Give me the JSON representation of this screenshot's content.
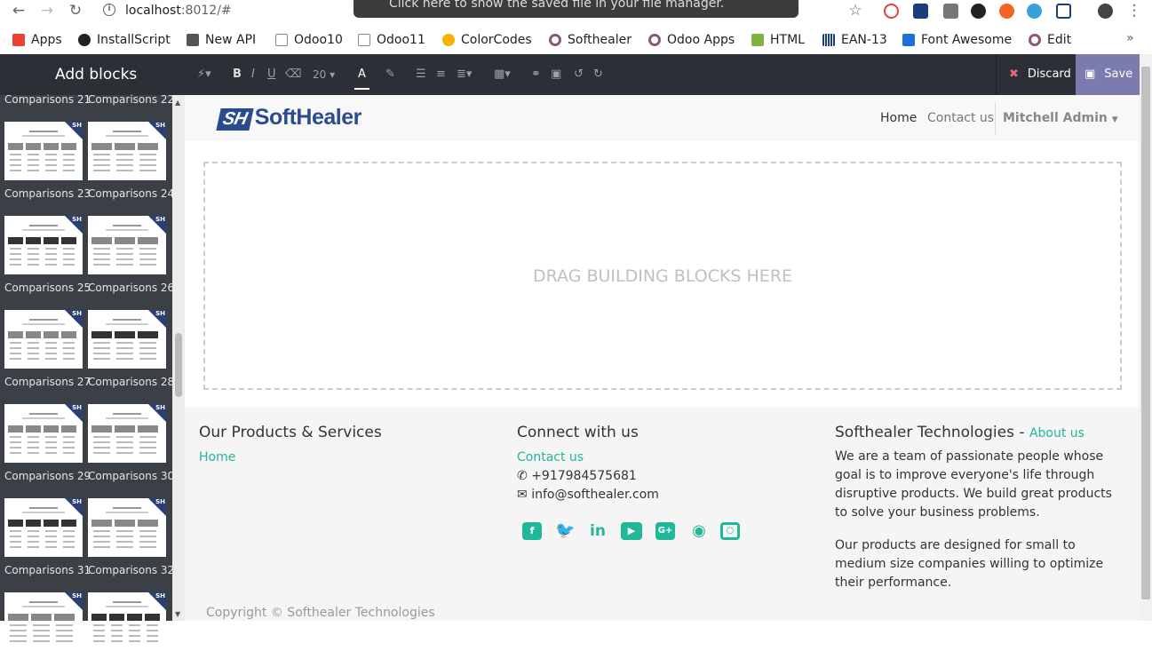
{
  "browser": {
    "url_host": "localhost",
    "url_rest": ":8012/#",
    "toast": "Click here to show the saved file in your file manager."
  },
  "bookmarks": [
    {
      "label": "Apps",
      "color": "#e94235"
    },
    {
      "label": "InstallScript",
      "color": "#202124"
    },
    {
      "label": "New API",
      "color": "#555555"
    },
    {
      "label": "Odoo10",
      "color": "#cccccc"
    },
    {
      "label": "Odoo11",
      "color": "#cccccc"
    },
    {
      "label": "ColorCodes",
      "color": "#f4b400"
    },
    {
      "label": "Softhealer",
      "color": "#875a7b"
    },
    {
      "label": "Odoo Apps",
      "color": "#875a7b"
    },
    {
      "label": "HTML",
      "color": "#7cb342"
    },
    {
      "label": "EAN-13",
      "color": "#1a3d7c"
    },
    {
      "label": "Font Awesome",
      "color": "#1e6fd9"
    },
    {
      "label": "Edit",
      "color": "#875a7b"
    }
  ],
  "sidebar": {
    "title": "Add blocks",
    "blocks": [
      "Comparisons 21",
      "Comparisons 22",
      "Comparisons 23",
      "Comparisons 24",
      "Comparisons 25",
      "Comparisons 26",
      "Comparisons 27",
      "Comparisons 28",
      "Comparisons 29",
      "Comparisons 30",
      "Comparisons 31",
      "Comparisons 32"
    ]
  },
  "toolbar": {
    "font_size": "20",
    "discard": "Discard",
    "save": "Save"
  },
  "site": {
    "logo": "SoftHealer",
    "logo_mark": "SH",
    "menu": {
      "home": "Home",
      "contact": "Contact us",
      "user": "Mitchell Admin"
    },
    "dropzone": "DRAG BUILDING BLOCKS HERE",
    "footer": {
      "products_title": "Our Products & Services",
      "products_link": "Home",
      "connect_title": "Connect with us",
      "connect_link": "Contact us",
      "phone": "+917984575681",
      "email": "info@softhealer.com",
      "company_title": "Softhealer Technologies",
      "company_sep": " - ",
      "about_link": "About us",
      "para1": "We are a team of passionate people whose goal is to improve everyone's life through disruptive products. We build great products to solve your business problems.",
      "para2": "Our products are designed for small to medium size companies willing to optimize their performance.",
      "copyright": "Copyright © Softhealer Technologies"
    },
    "social": [
      "facebook",
      "twitter",
      "linkedin",
      "youtube",
      "google-plus",
      "github",
      "instagram"
    ]
  },
  "colors": {
    "accent": "#21b799",
    "save": "#7c7bad",
    "toolbar": "#2c2f36"
  }
}
